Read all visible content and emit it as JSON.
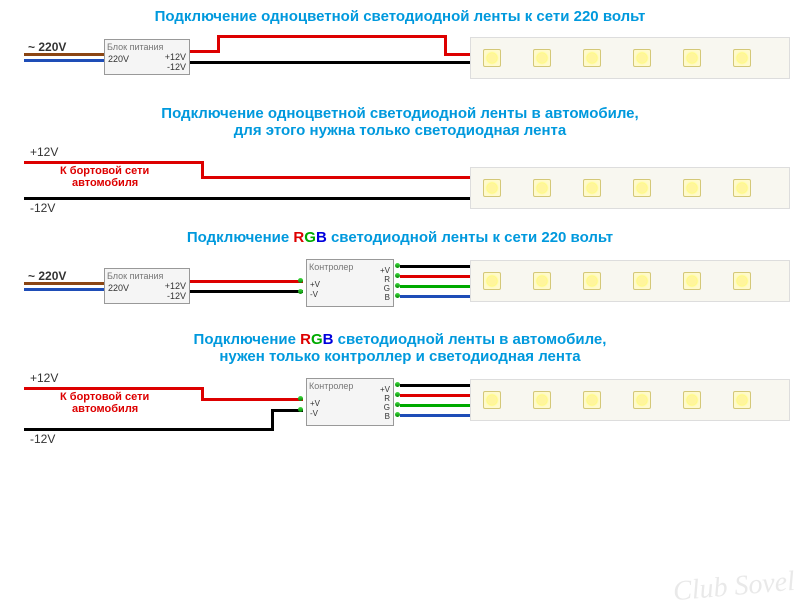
{
  "titles": {
    "t1": "Подключение одноцветной светодиодной ленты к сети 220 вольт",
    "t2a": "Подключение одноцветной светодиодной ленты в автомобиле,",
    "t2b": "для этого нужна только светодиодная лента",
    "t3_pre": "Подключение ",
    "t3_r": "R",
    "t3_g": "G",
    "t3_b": "B",
    "t3_post": " светодиодной ленты к сети 220 вольт",
    "t4a_pre": "Подключение ",
    "t4a_post": " светодиодной ленты в автомобиле,",
    "t4b": "нужен только контроллер и светодиодная лента"
  },
  "labels": {
    "ac220": "~ 220V",
    "p12": "+12V",
    "m12": "-12V",
    "car": "К бортовой сети",
    "car2": "автомобиля",
    "psu_title": "Блок питания",
    "psu_in": "220V",
    "ctrl_title": "Контролер",
    "pV": "+V",
    "mV": "-V",
    "R": "R",
    "G": "G",
    "B": "B"
  },
  "colors": {
    "title": "#0099dd",
    "red": "#d00",
    "green": "#0a0",
    "blue": "#00d"
  },
  "watermark": "Club Sovel"
}
